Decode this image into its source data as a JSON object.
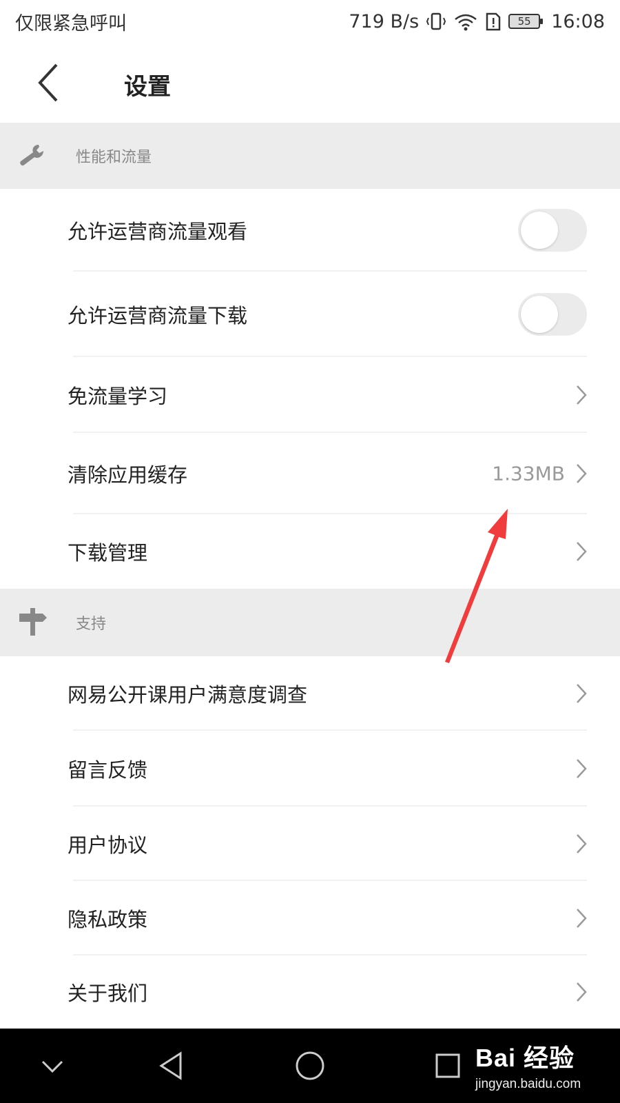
{
  "status_bar": {
    "carrier": "仅限紧急呼叫",
    "net_speed": "719 B/s",
    "battery": "55",
    "time": "16:08"
  },
  "header": {
    "title": "设置"
  },
  "sections": {
    "performance": {
      "label": "性能和流量",
      "icon": "wrench-icon",
      "rows": [
        {
          "label": "允许运营商流量观看",
          "toggle": false
        },
        {
          "label": "允许运营商流量下载",
          "toggle": false
        },
        {
          "label": "免流量学习"
        },
        {
          "label": "清除应用缓存",
          "value": "1.33MB"
        },
        {
          "label": "下载管理"
        }
      ]
    },
    "support": {
      "label": "支持",
      "icon": "signpost-icon",
      "rows": [
        {
          "label": "网易公开课用户满意度调查"
        },
        {
          "label": "留言反馈"
        },
        {
          "label": "用户协议"
        },
        {
          "label": "隐私政策"
        },
        {
          "label": "关于我们"
        }
      ]
    }
  },
  "watermark": {
    "brand": "Bai 经验",
    "url": "jingyan.baidu.com"
  },
  "colors": {
    "section_bg": "#ececec",
    "annotation_arrow": "#f03c3c",
    "navbar": "#000000"
  }
}
